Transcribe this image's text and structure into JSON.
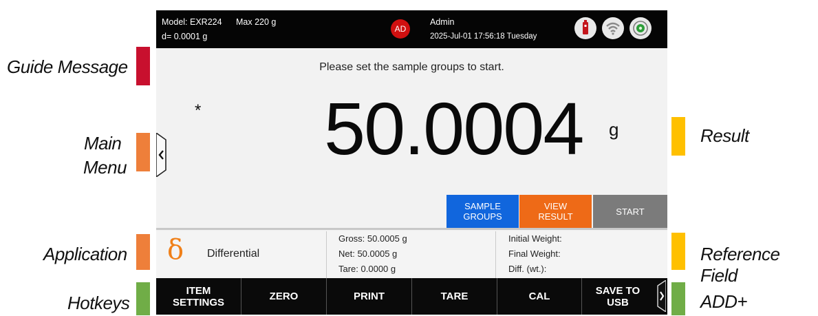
{
  "status_bar": {
    "model": "Model: EXR224",
    "max": "Max 220 g",
    "readability": "d= 0.0001 g",
    "user_initials": "AD",
    "user_name": "Admin",
    "datetime": "2025-Jul-01 17:56:18 Tuesday",
    "icons": [
      "usb-icon",
      "wifi-icon",
      "level-bubble-icon"
    ]
  },
  "guide_message": "Please set the sample groups to start.",
  "stability_indicator": "*",
  "result": {
    "value": "50.0004",
    "unit": "g"
  },
  "action_buttons": [
    {
      "line1": "SAMPLE",
      "line2": "GROUPS",
      "color": "#1166dd"
    },
    {
      "line1": "VIEW",
      "line2": "RESULT",
      "color": "#ee6a17"
    },
    {
      "line1": "START",
      "line2": "",
      "color": "#7b7b7b"
    }
  ],
  "application": {
    "symbol": "δ",
    "name": "Differential",
    "symbol_color": "#f08019"
  },
  "weights": {
    "gross": "Gross: 50.0005 g",
    "net": "Net: 50.0005 g",
    "tare": "Tare: 0.0000 g"
  },
  "reference_field": {
    "initial": "Initial Weight:",
    "final": "Final Weight:",
    "diff": "Diff. (wt.):"
  },
  "hotkeys": [
    {
      "line1": "ITEM",
      "line2": "SETTINGS"
    },
    {
      "line1": "ZERO",
      "line2": ""
    },
    {
      "line1": "PRINT",
      "line2": ""
    },
    {
      "line1": "TARE",
      "line2": ""
    },
    {
      "line1": "CAL",
      "line2": ""
    },
    {
      "line1": "SAVE TO",
      "line2": "USB"
    }
  ],
  "callouts": {
    "guide_message": "Guide Message",
    "main_menu_1": "Main",
    "main_menu_2": "Menu",
    "application": "Application",
    "hotkeys": "Hotkeys",
    "result": "Result",
    "reference_field": "Reference Field",
    "add_plus": "ADD+"
  },
  "colors": {
    "red": "#c8102e",
    "orange": "#ee7f3a",
    "yellow": "#ffc000",
    "green": "#70ad47"
  }
}
